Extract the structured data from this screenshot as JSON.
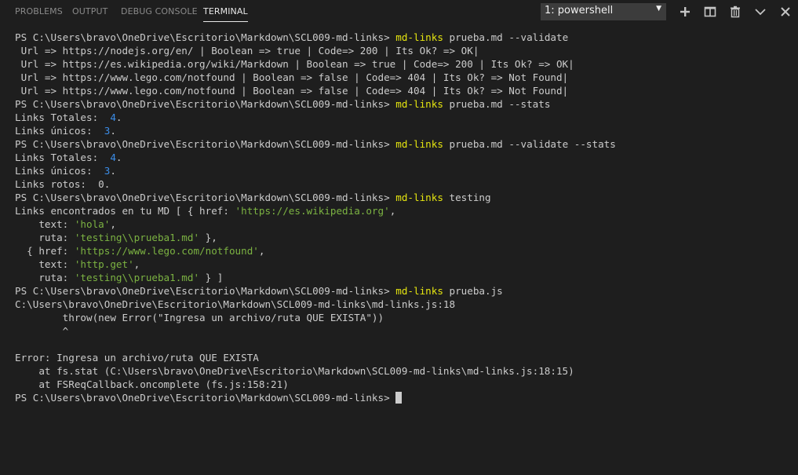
{
  "tabs": {
    "problems": "PROBLEMS",
    "output": "OUTPUT",
    "debug_console": "DEBUG CONSOLE",
    "terminal": "TERMINAL"
  },
  "terminal_select": {
    "value": "1: powershell",
    "caret": "▼"
  },
  "actions": [
    "plus-icon",
    "split-icon",
    "trash-icon",
    "chevron-down-icon",
    "close-icon"
  ],
  "colors": {
    "background": "#1e1e1e",
    "text": "#cccccc",
    "command": "#e5e510",
    "number": "#3b8eea",
    "string": "#7cb342"
  },
  "prompt": "PS C:\\Users\\bravo\\OneDrive\\Escritorio\\Markdown\\SCL009-md-links> ",
  "command": "md-links",
  "lines": [
    {
      "type": "prompt",
      "args": " prueba.md --validate"
    },
    {
      "type": "text",
      "text": " Url => https://nodejs.org/en/ | Boolean => true | Code=> 200 | Its Ok? => OK|"
    },
    {
      "type": "text",
      "text": " Url => https://es.wikipedia.org/wiki/Markdown | Boolean => true | Code=> 200 | Its Ok? => OK|"
    },
    {
      "type": "text",
      "text": " Url => https://www.lego.com/notfound | Boolean => false | Code=> 404 | Its Ok? => Not Found|"
    },
    {
      "type": "text",
      "text": " Url => https://www.lego.com/notfound | Boolean => false | Code=> 404 | Its Ok? => Not Found|"
    },
    {
      "type": "prompt",
      "args": " prueba.md --stats"
    },
    {
      "type": "text",
      "text": "Links Totales:  ",
      "num": "4",
      "tail": "."
    },
    {
      "type": "text",
      "text": "Links únicos:  ",
      "num": "3",
      "tail": "."
    },
    {
      "type": "prompt",
      "args": " prueba.md --validate --stats"
    },
    {
      "type": "text",
      "text": "Links Totales:  ",
      "num": "4",
      "tail": "."
    },
    {
      "type": "text",
      "text": "Links únicos:  ",
      "num": "3",
      "tail": "."
    },
    {
      "type": "text",
      "text": "Links rotos:  0."
    },
    {
      "type": "prompt",
      "args": " testing"
    },
    {
      "type": "text",
      "text": "Links encontrados en tu MD [ { href: ",
      "str": "'https://es.wikipedia.org'",
      "tail": ","
    },
    {
      "type": "text",
      "text": "    text: ",
      "str": "'hola'",
      "tail": ","
    },
    {
      "type": "text",
      "text": "    ruta: ",
      "str": "'testing\\\\prueba1.md'",
      "tail": " },"
    },
    {
      "type": "text",
      "text": "  { href: ",
      "str": "'https://www.lego.com/notfound'",
      "tail": ","
    },
    {
      "type": "text",
      "text": "    text: ",
      "str": "'http.get'",
      "tail": ","
    },
    {
      "type": "text",
      "text": "    ruta: ",
      "str": "'testing\\\\prueba1.md'",
      "tail": " } ]"
    },
    {
      "type": "prompt",
      "args": " prueba.js"
    },
    {
      "type": "text",
      "text": "C:\\Users\\bravo\\OneDrive\\Escritorio\\Markdown\\SCL009-md-links\\md-links.js:18"
    },
    {
      "type": "text",
      "text": "        throw(new Error(\"Ingresa un archivo/ruta QUE EXISTA\"))"
    },
    {
      "type": "text",
      "text": "        ^"
    },
    {
      "type": "text",
      "text": ""
    },
    {
      "type": "text",
      "text": "Error: Ingresa un archivo/ruta QUE EXISTA"
    },
    {
      "type": "text",
      "text": "    at fs.stat (C:\\Users\\bravo\\OneDrive\\Escritorio\\Markdown\\SCL009-md-links\\md-links.js:18:15)"
    },
    {
      "type": "text",
      "text": "    at FSReqCallback.oncomplete (fs.js:158:21)"
    },
    {
      "type": "cursor"
    }
  ]
}
